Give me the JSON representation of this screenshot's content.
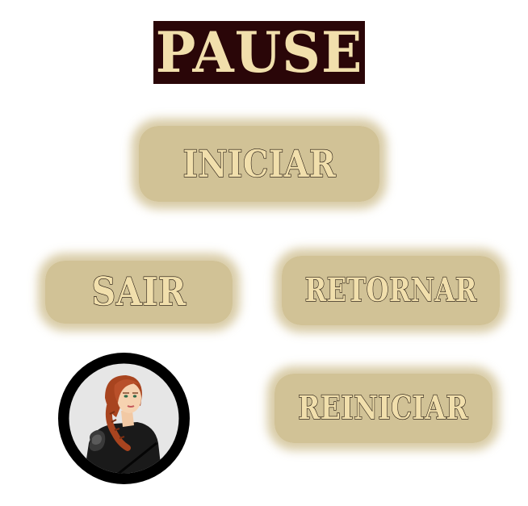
{
  "screen": {
    "title": "PAUSE"
  },
  "menu": {
    "start_label": "INICIAR",
    "exit_label": "SAIR",
    "resume_label": "RETORNAR",
    "restart_label": "REINICIAR"
  },
  "colors": {
    "title_background": "#2a0608",
    "title_text": "#f1dfac",
    "button_background": "#cbba87",
    "button_text": "#f1dfac",
    "text_outline": "#1b1008",
    "avatar_ring": "#000000",
    "avatar_background": "#e6e6e6"
  },
  "avatar": {
    "character": "red-haired woman in black outfit",
    "icon": "character-portrait-icon"
  }
}
